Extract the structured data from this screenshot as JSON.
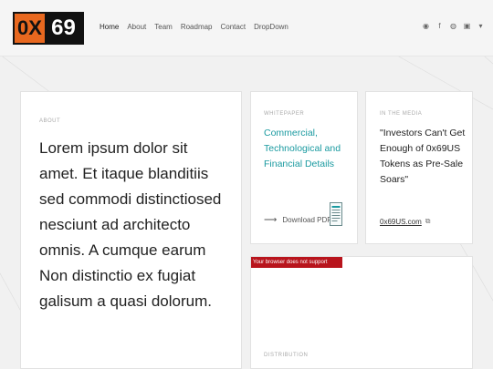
{
  "logo": {
    "left_text": "0X",
    "right_text": "69"
  },
  "nav": {
    "items": [
      "Home",
      "About",
      "Team",
      "Roadmap",
      "Contact",
      "DropDown"
    ],
    "active": "Home"
  },
  "social": {
    "icons": [
      "telegram-icon",
      "facebook-icon",
      "reddit-icon",
      "youtube-icon",
      "twitter-icon"
    ],
    "glyphs": [
      "◉",
      "f",
      "◍",
      "▣",
      "▾"
    ]
  },
  "about": {
    "eyebrow": "ABOUT",
    "text": "Lorem ipsum dolor sit amet. Et itaque blanditiis sed commodi distinctiosed nesciunt ad architecto omnis. A cumque earum Non distinctio ex fugiat galisum a quasi dolorum."
  },
  "whitepaper": {
    "eyebrow": "WHITEPAPER",
    "title": "Commercial, Technological and Financial Details",
    "download_label": "Download PDF",
    "download_arrow": "⟶"
  },
  "media": {
    "eyebrow": "IN THE MEDIA",
    "title": "\"Investors Can't Get Enough of 0x69US Tokens as Pre-Sale Soars\"",
    "link_text": "0x69US.com",
    "link_icon": "⧉"
  },
  "distribution": {
    "error_text": "Your browser does not support charts",
    "eyebrow": "DISTRIBUTION"
  },
  "colors": {
    "accent": "#1a9aa0",
    "logo_orange": "#e8681f",
    "error_red": "#b8141c"
  }
}
